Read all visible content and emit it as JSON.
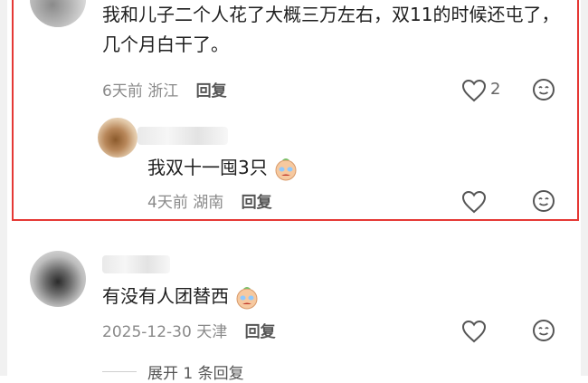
{
  "comments": [
    {
      "text": "我和儿子二个人花了大概三万左右，双11的时候还屯了，几个月白干了。",
      "time": "6天前",
      "location": "浙江",
      "reply_label": "回复",
      "likes": "2"
    },
    {
      "text": "我双十一囤3只",
      "time": "4天前",
      "location": "湖南",
      "reply_label": "回复"
    },
    {
      "text": "有没有人团替西",
      "time": "2025-12-30",
      "location": "天津",
      "reply_label": "回复"
    }
  ],
  "expand_label": "展开 1 条回复",
  "colors": {
    "highlight": "#e53935",
    "meta": "#8a8a8a",
    "icon": "#555555"
  },
  "icons": [
    "heart-outline-icon",
    "smile-outline-icon",
    "crying-emoji-icon"
  ]
}
